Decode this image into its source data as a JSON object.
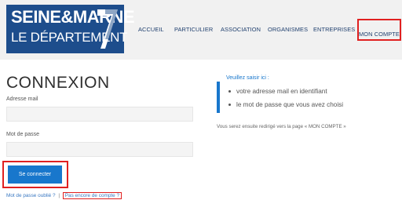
{
  "header": {
    "logo": {
      "line1": "SEINE&MARNE",
      "line2": "LE DÉPARTEMENT",
      "mark": "77"
    },
    "nav": [
      {
        "label": "ACCUEIL"
      },
      {
        "label": "PARTICULIER"
      },
      {
        "label": "ASSOCIATION"
      },
      {
        "label": "ORGANISMES"
      },
      {
        "label": "ENTREPRISES"
      },
      {
        "label": "MON COMPTE"
      }
    ]
  },
  "login": {
    "title": "CONNEXION",
    "email_label": "Adresse mail",
    "email_value": "",
    "password_label": "Mot de passe",
    "password_value": "",
    "submit_label": "Se connecter",
    "forgot_link": "Mot de passe oublié ?",
    "separator": "|",
    "register_link": "Pas encore de compte ?"
  },
  "info": {
    "heading": "Veuillez saisir ici :",
    "items": [
      "votre adresse mail en identifiant",
      "le mot de passe que vous avez choisi"
    ],
    "note": "Vous serez ensuite redirigé vers la page « MON COMPTE »"
  },
  "colors": {
    "brand": "#1d4d8c",
    "accent": "#1877cc",
    "highlight": "#e02020"
  }
}
